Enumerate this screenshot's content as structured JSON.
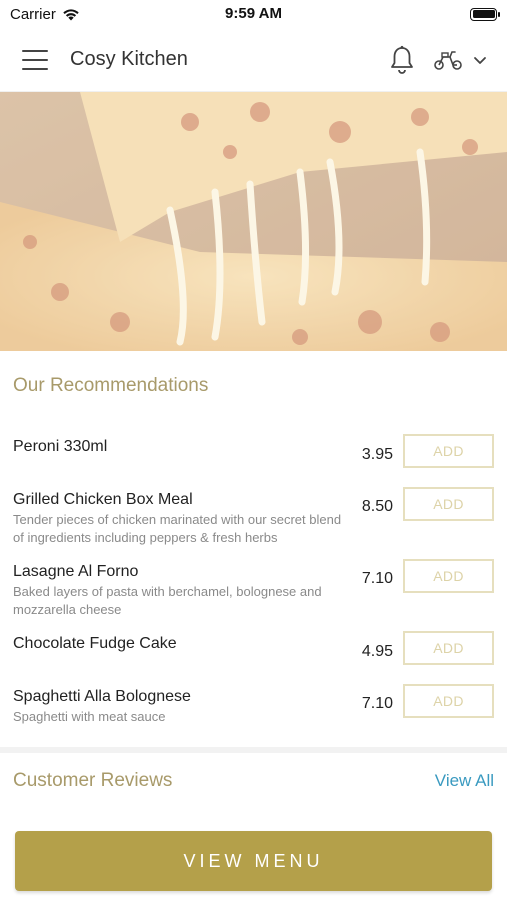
{
  "status_bar": {
    "carrier": "Carrier",
    "time": "9:59 AM"
  },
  "header": {
    "title": "Cosy Kitchen",
    "icons": [
      "menu-icon",
      "bell-icon",
      "scooter-icon",
      "chevron-down-icon"
    ]
  },
  "hero": {
    "image": "cheese-pizza-slice"
  },
  "recommendations": {
    "title": "Our Recommendations",
    "items": [
      {
        "name": "Peroni 330ml",
        "description": "",
        "price": "3.95",
        "button": "ADD"
      },
      {
        "name": "Grilled Chicken Box Meal",
        "description": "Tender pieces of chicken marinated with our secret blend of ingredients including peppers & fresh herbs",
        "price": "8.50",
        "button": "ADD"
      },
      {
        "name": "Lasagne Al Forno",
        "description": "Baked layers of pasta with berchamel, bolognese and mozzarella cheese",
        "price": "7.10",
        "button": "ADD"
      },
      {
        "name": "Chocolate Fudge Cake",
        "description": "",
        "price": "4.95",
        "button": "ADD"
      },
      {
        "name": "Spaghetti Alla Bolognese",
        "description": "Spaghetti with meat sauce",
        "price": "7.10",
        "button": "ADD"
      }
    ]
  },
  "reviews": {
    "title": "Customer Reviews",
    "view_all": "View All"
  },
  "cta": {
    "label": "VIEW MENU"
  },
  "colors": {
    "accent": "#b4a04a",
    "heading": "#a89a6a",
    "link": "#3a9ac0",
    "add_border": "#e6dfbe"
  }
}
